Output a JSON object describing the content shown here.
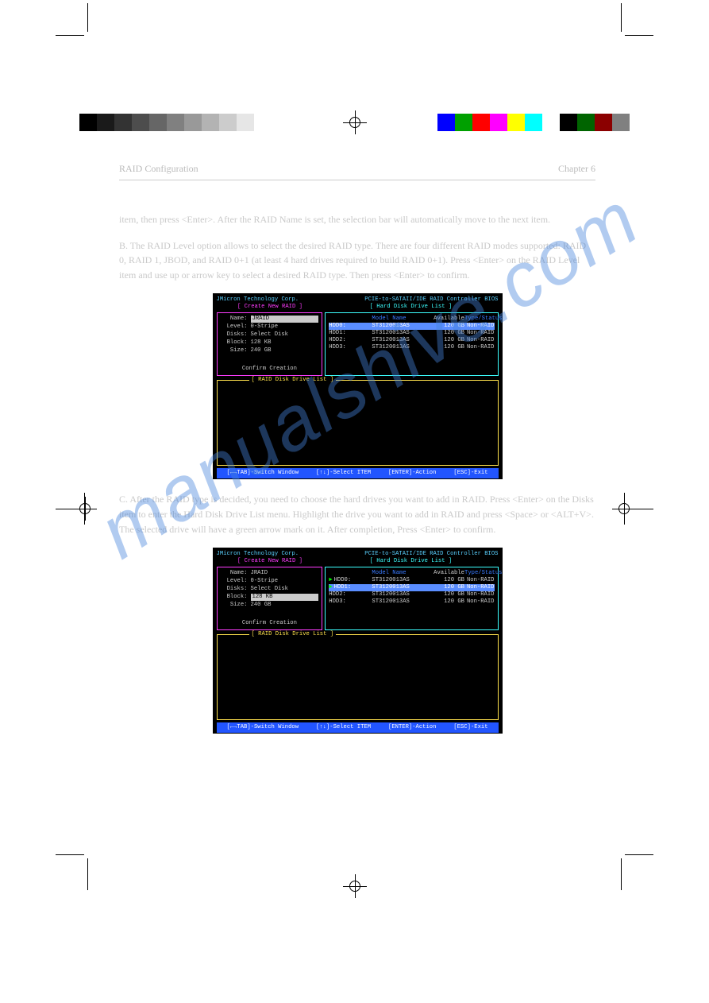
{
  "watermark": "manualshive.com",
  "header": {
    "chapter": "RAID Configuration",
    "section": "Chapter 6"
  },
  "paragraphs": {
    "p1": "item, then press <Enter>. After the RAID Name is set, the selection bar will automatically move to the next item.",
    "p2": "B. The RAID Level option allows to select the desired RAID type. There are four different RAID modes supported: RAID 0, RAID 1, JBOD, and RAID 0+1 (at least 4 hard drives required to build RAID 0+1). Press <Enter> on the RAID Level item and use up or arrow key to select a desired RAID type. Then press <Enter> to confirm.",
    "p3": "C. After the RAID type is decided, you need to choose the hard drives you want to add in RAID. Press <Enter> on the Disks item to enter the Hard Disk Drive List menu. Highlight the drive you want to add in RAID and press <Space> or <ALT+V>. The selected drive will have a green arrow mark on it. After completion, Press <Enter> to confirm."
  },
  "bios_common": {
    "title_left": "JMicron Technology Corp.",
    "title_right": "PCIE-to-SATAII/IDE RAID Controller BIOS",
    "create_title": "[ Create New RAID ]",
    "drivelist_title": "[ Hard Disk Drive List ]",
    "raidlist_title": "[ RAID Disk Drive List ]",
    "labels": {
      "name": "Name:",
      "level": "Level:",
      "disks": "Disks:",
      "block": "Block:",
      "size": "Size:"
    },
    "confirm": "Confirm Creation",
    "headers": {
      "model": "Model Name",
      "avail": "Available",
      "type": "Type/Status"
    },
    "help": {
      "tab": "[←→TAB]-Switch Window",
      "updown": "[↑↓]-Select ITEM",
      "enter": "[ENTER]-Action",
      "esc": "[ESC]-Exit"
    }
  },
  "bios1": {
    "values": {
      "name": "JRAID",
      "level": "0-Stripe",
      "disks": "Select Disk",
      "block": "128 KB",
      "size": "240 GB"
    },
    "active_field": "name",
    "drives": [
      {
        "id": "HDD0:",
        "model": "ST3120013AS",
        "size": "120 GB",
        "status": "Non-RAID",
        "selected": true,
        "marked": false
      },
      {
        "id": "HDD1:",
        "model": "ST3120013AS",
        "size": "120 GB",
        "status": "Non-RAID",
        "selected": false,
        "marked": false
      },
      {
        "id": "HDD2:",
        "model": "ST3120013AS",
        "size": "120 GB",
        "status": "Non-RAID",
        "selected": false,
        "marked": false
      },
      {
        "id": "HDD3:",
        "model": "ST3120013AS",
        "size": "120 GB",
        "status": "Non-RAID",
        "selected": false,
        "marked": false
      }
    ]
  },
  "bios2": {
    "values": {
      "name": "JRAID",
      "level": "0-Stripe",
      "disks": "Select Disk",
      "block": "128 KB",
      "size": "240 GB"
    },
    "active_field": "block",
    "drives": [
      {
        "id": "HDD0:",
        "model": "ST3120013AS",
        "size": "120 GB",
        "status": "Non-RAID",
        "selected": false,
        "marked": true
      },
      {
        "id": "HDD1:",
        "model": "ST3120013AS",
        "size": "120 GB",
        "status": "Non-RAID",
        "selected": true,
        "marked": true
      },
      {
        "id": "HDD2:",
        "model": "ST3120013AS",
        "size": "120 GB",
        "status": "Non-RAID",
        "selected": false,
        "marked": false
      },
      {
        "id": "HDD3:",
        "model": "ST3120013AS",
        "size": "120 GB",
        "status": "Non-RAID",
        "selected": false,
        "marked": false
      }
    ]
  },
  "swatches": {
    "gray": [
      "#000000",
      "#1a1a1a",
      "#333333",
      "#4d4d4d",
      "#666666",
      "#808080",
      "#999999",
      "#b3b3b3",
      "#cccccc",
      "#e6e6e6",
      "#ffffff"
    ],
    "color": [
      "#0000ff",
      "#00a000",
      "#ff0000",
      "#ff00ff",
      "#ffff00",
      "#00ffff",
      "#ffffff",
      "#000000",
      "#006400",
      "#8b0000",
      "#808080"
    ]
  }
}
